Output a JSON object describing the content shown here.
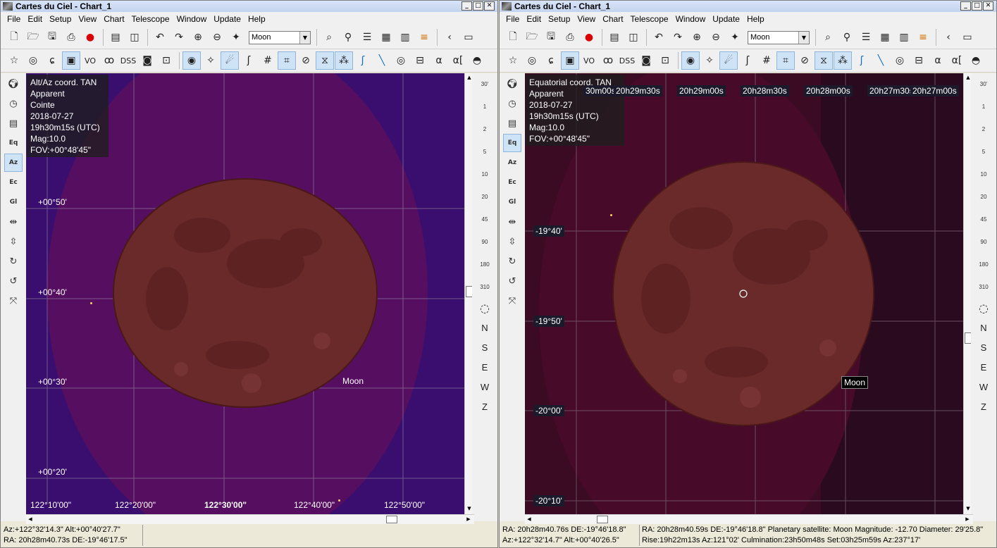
{
  "app": {
    "title_left": "Cartes du Ciel - Chart_1",
    "title_right": "Cartes du Ciel - Chart_1"
  },
  "menu": [
    "File",
    "Edit",
    "Setup",
    "View",
    "Chart",
    "Telescope",
    "Window",
    "Update",
    "Help"
  ],
  "toolbar": {
    "object_select": "Moon",
    "vo_label": "VO",
    "dss_label": "DSS",
    "alpha_label": "α",
    "alpha_bracket_label": "α["
  },
  "leftbar": {
    "grid_eq": "Eq",
    "grid_az": "Az",
    "grid_ec": "Ec",
    "grid_gl": "Gl"
  },
  "fov_scale": [
    "30'",
    "1",
    "2",
    "5",
    "10",
    "20",
    "45",
    "90",
    "180",
    "310"
  ],
  "directions": [
    "N",
    "S",
    "E",
    "W",
    "Z"
  ],
  "left_chart": {
    "info": [
      "Alt/Az coord. TAN",
      "Apparent",
      "Cointe",
      "2018-07-27",
      "19h30m15s (UTC)",
      "Mag:10.0",
      "FOV:+00°48'45\""
    ],
    "alt_labels": [
      "+00°50'",
      "+00°40'",
      "+00°30'",
      "+00°20'"
    ],
    "az_labels": [
      "122°10'00\"",
      "122°20'00\"",
      "122°30'00\"",
      "122°40'00\"",
      "122°50'00\""
    ],
    "object_label": "Moon",
    "colors": {
      "sky": "#3a0e6e",
      "moon_halo": "#5c0f5e",
      "moon_disk": "#6b2a2a"
    }
  },
  "right_chart": {
    "info": [
      "Equatorial coord. TAN",
      "Apparent",
      "2018-07-27",
      "19h30m15s (UTC)",
      "Mag:10.0",
      "FOV:+00°48'45\""
    ],
    "ra_labels": [
      "20h29m30s",
      "20h29m00s",
      "20h28m30s",
      "20h28m00s",
      "20h27m30s",
      "20h27m00s"
    ],
    "ra_partial": "30m00s",
    "dec_labels": [
      "-19°40'",
      "-19°50'",
      "-20°00'",
      "-20°10'"
    ],
    "object_label": "Moon",
    "colors": {
      "sky": "#3a0b22",
      "moon_halo": "#4a0a2a",
      "moon_disk": "#6b2a2a"
    }
  },
  "status_left": {
    "line1": "Az:+122°32'14.3\" Alt:+00°40'27.7\"",
    "line2": "RA: 20h28m40.73s DE:-19°46'17.5\""
  },
  "status_right": {
    "line1a": "RA: 20h28m40.76s DE:-19°46'18.8\"",
    "line2a": "Az:+122°32'14.7\" Alt:+00°40'26.5\"",
    "line1b": "RA: 20h28m40.59s DE:-19°46'18.8\"  Planetary satellite: Moon  Magnitude: -12.70  Diameter: 29'25.8\"",
    "line2b": "Rise:19h22m13s Az:121°02'  Culmination:23h50m48s  Set:03h25m59s Az:237°17'"
  }
}
